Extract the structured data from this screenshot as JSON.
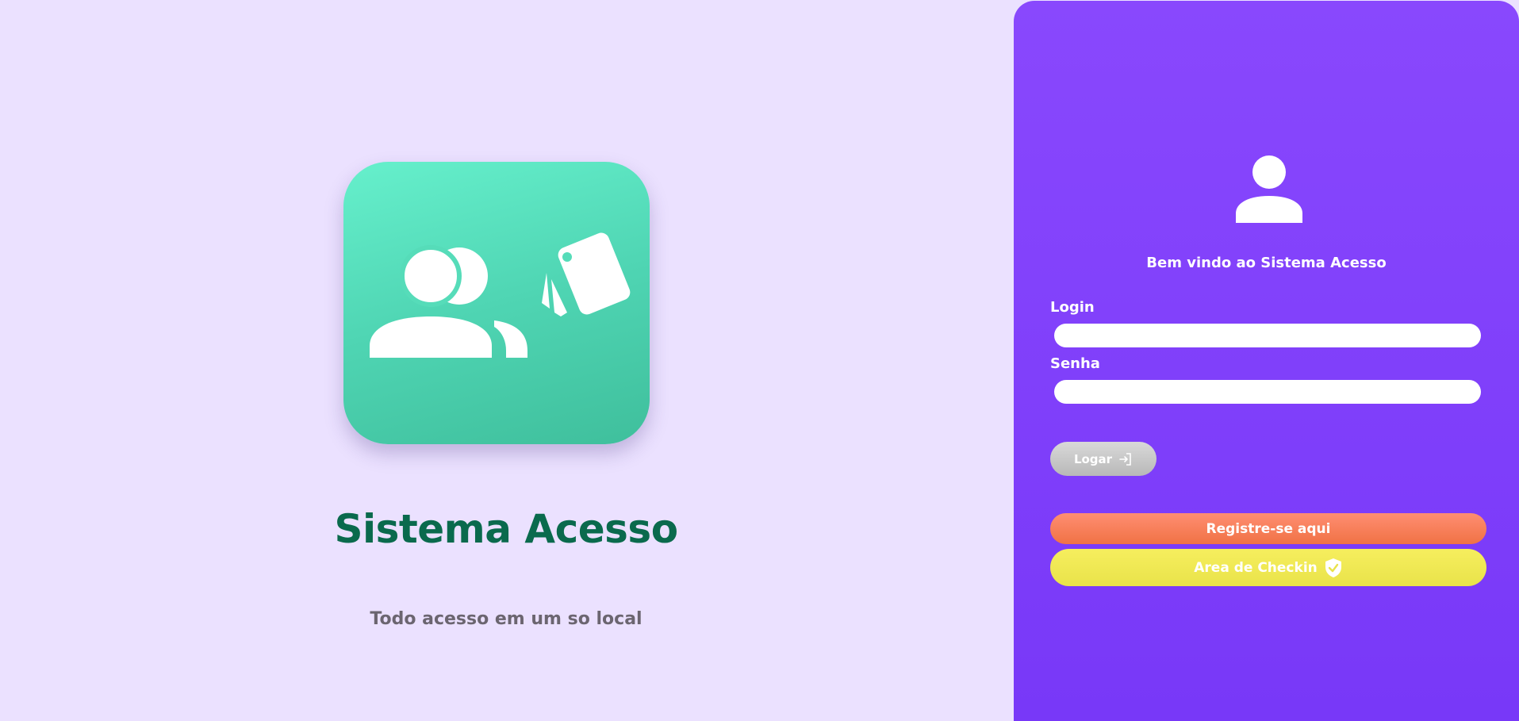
{
  "brand": {
    "title": "Sistema Acesso",
    "tagline": "Todo acesso em um so local",
    "icon": "users-badge-icon",
    "icon_color": "#4fd5b3",
    "title_color": "#0a6a4d"
  },
  "login_panel": {
    "background_color": "#7f40fb",
    "user_icon": "user-icon",
    "welcome": "Bem vindo ao Sistema Acesso",
    "login_label": "Login",
    "login_value": "",
    "senha_label": "Senha",
    "senha_value": "",
    "logar_button": {
      "label": "Logar",
      "icon": "login-arrow-icon"
    },
    "register_button": {
      "label": "Registre-se aqui",
      "color": "#f47e57"
    },
    "checkin_button": {
      "label": "Area de Checkin",
      "icon": "shield-check-icon",
      "color": "#efe854"
    }
  }
}
